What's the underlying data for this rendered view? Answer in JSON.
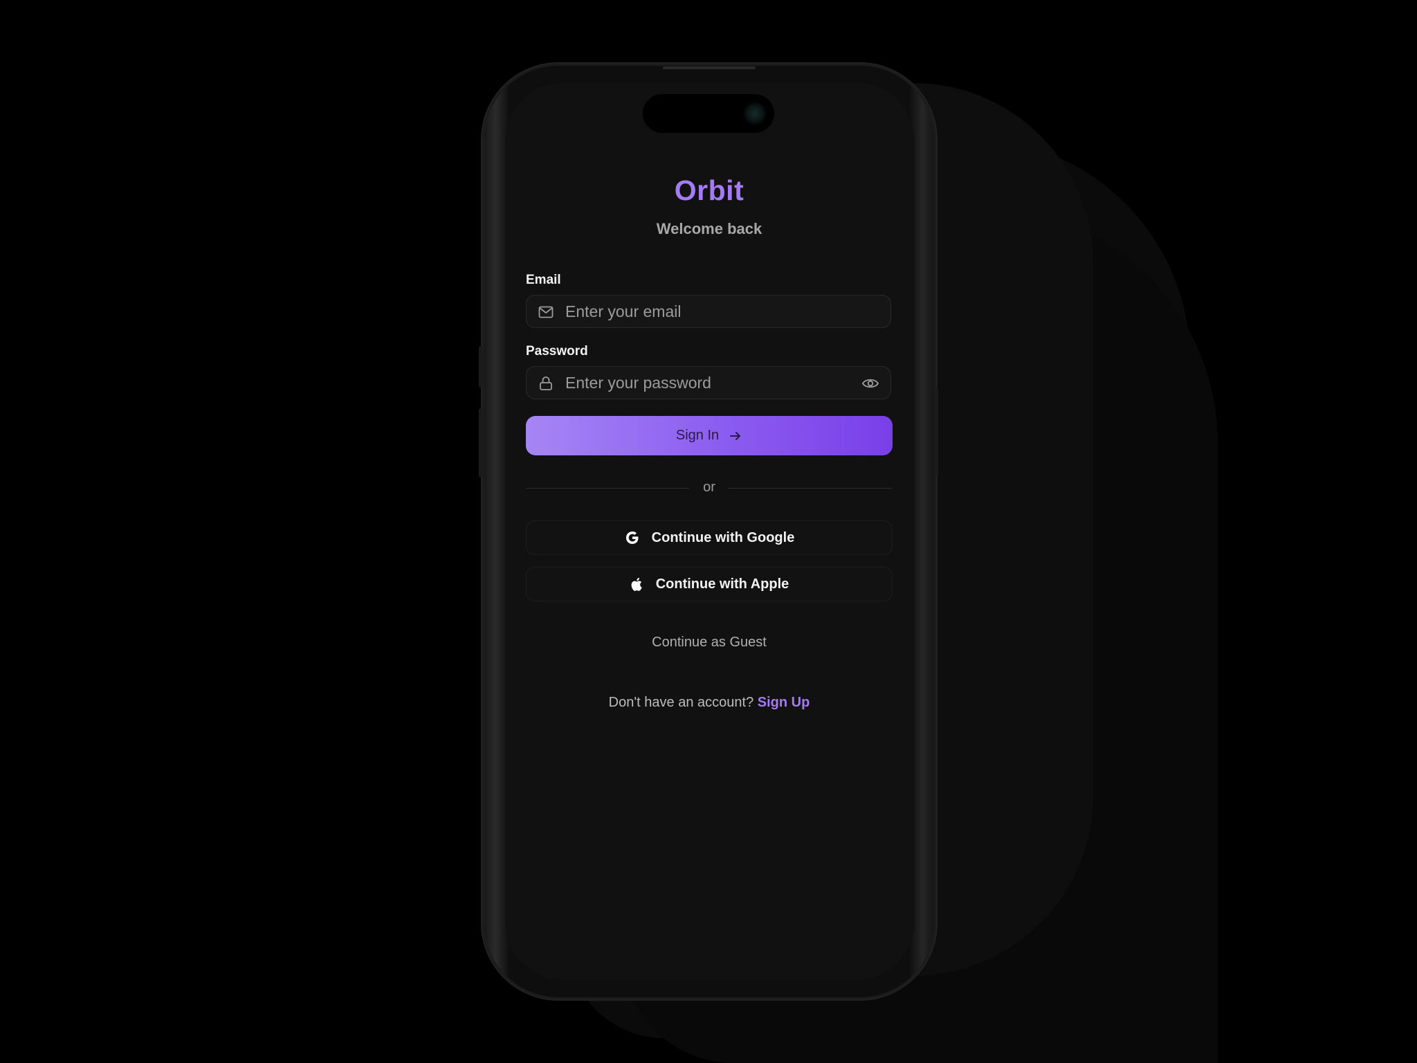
{
  "app": {
    "title": "Orbit",
    "subtitle": "Welcome back"
  },
  "colors": {
    "accent": "#a47bf2",
    "background": "#111111",
    "button_gradient_start": "#a586f5",
    "button_gradient_end": "#7a3fe8"
  },
  "form": {
    "email": {
      "label": "Email",
      "placeholder": "Enter your email",
      "value": "",
      "icon": "mail-icon"
    },
    "password": {
      "label": "Password",
      "placeholder": "Enter your password",
      "value": "",
      "icon": "lock-icon",
      "toggle_icon": "eye-icon"
    },
    "submit_label": "Sign In",
    "submit_icon": "arrow-right-icon"
  },
  "divider": {
    "text": "or"
  },
  "social": {
    "google_label": "Continue with Google",
    "apple_label": "Continue with Apple"
  },
  "guest_label": "Continue as Guest",
  "signup": {
    "prompt": "Don't have an account?",
    "link_label": "Sign Up"
  }
}
